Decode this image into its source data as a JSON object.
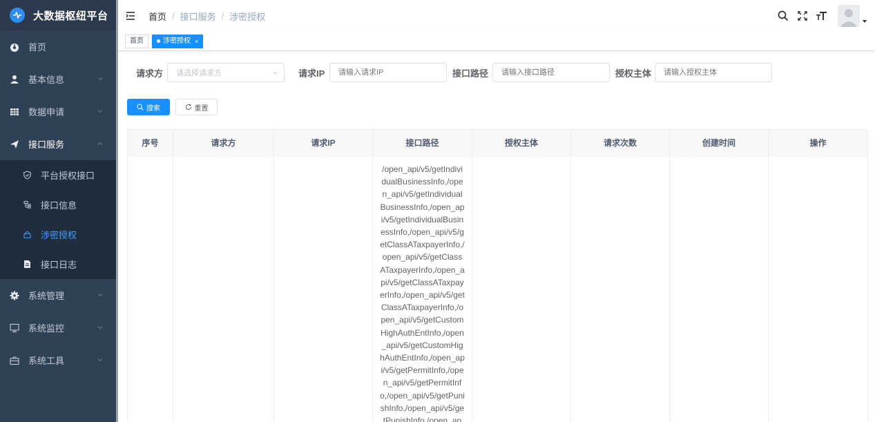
{
  "app": {
    "title": "大数据枢纽平台"
  },
  "sidebar": {
    "items": [
      {
        "label": "首页",
        "icon": "dashboard-icon"
      },
      {
        "label": "基本信息",
        "icon": "user-icon"
      },
      {
        "label": "数据申请",
        "icon": "grid-icon"
      },
      {
        "label": "接口服务",
        "icon": "send-icon",
        "children": [
          {
            "label": "平台授权接口",
            "icon": "shield-icon"
          },
          {
            "label": "接口信息",
            "icon": "tree-icon"
          },
          {
            "label": "涉密授权",
            "icon": "lock-icon",
            "active": true
          },
          {
            "label": "接口日志",
            "icon": "log-icon"
          }
        ]
      },
      {
        "label": "系统管理",
        "icon": "gear-icon"
      },
      {
        "label": "系统监控",
        "icon": "monitor-icon"
      },
      {
        "label": "系统工具",
        "icon": "toolbox-icon"
      }
    ]
  },
  "breadcrumb": [
    "首页",
    "接口服务",
    "涉密授权"
  ],
  "tags": [
    {
      "label": "首页",
      "active": false
    },
    {
      "label": "涉密授权",
      "active": true,
      "close": "×"
    }
  ],
  "form": {
    "requester": {
      "label": "请求方",
      "placeholder": "请选择请求方"
    },
    "ip": {
      "label": "请求IP",
      "placeholder": "请输入请求IP"
    },
    "path": {
      "label": "接口路径",
      "placeholder": "请输入接口路径"
    },
    "subject": {
      "label": "授权主体",
      "placeholder": "请输入授权主体"
    },
    "search_label": "搜索",
    "reset_label": "重置"
  },
  "table": {
    "columns": [
      "序号",
      "请求方",
      "请求IP",
      "接口路径",
      "授权主体",
      "请求次数",
      "创建时间",
      "操作"
    ],
    "rows": [
      {
        "index": "",
        "requester": "",
        "ip": "",
        "path": "/open_api/v5/getIndividualBusinessInfo,/open_api/v5/getIndividualBusinessInfo,/open_api/v5/getIndividualBusinessInfo,/open_api/v5/getClassATaxpayerInfo,/open_api/v5/getClassATaxpayerInfo,/open_api/v5/getClassATaxpayerInfo,/open_api/v5/getClassATaxpayerInfo,/open_api/v5/getCustomHighAuthEntInfo,/open_api/v5/getCustomHighAuthEntInfo,/open_api/v5/getPermitInfo,/open_api/v5/getPermitInfo,/open_api/v5/getPunishInfo,/open_api/v5/getPunishInfo,/open_ap",
        "subject": "",
        "count": "",
        "created": "",
        "actions": ""
      }
    ]
  },
  "colors": {
    "sidebar_bg": "#304156",
    "submenu_bg": "#1f2d3d",
    "accent": "#1890ff",
    "active_text": "#409eff"
  }
}
